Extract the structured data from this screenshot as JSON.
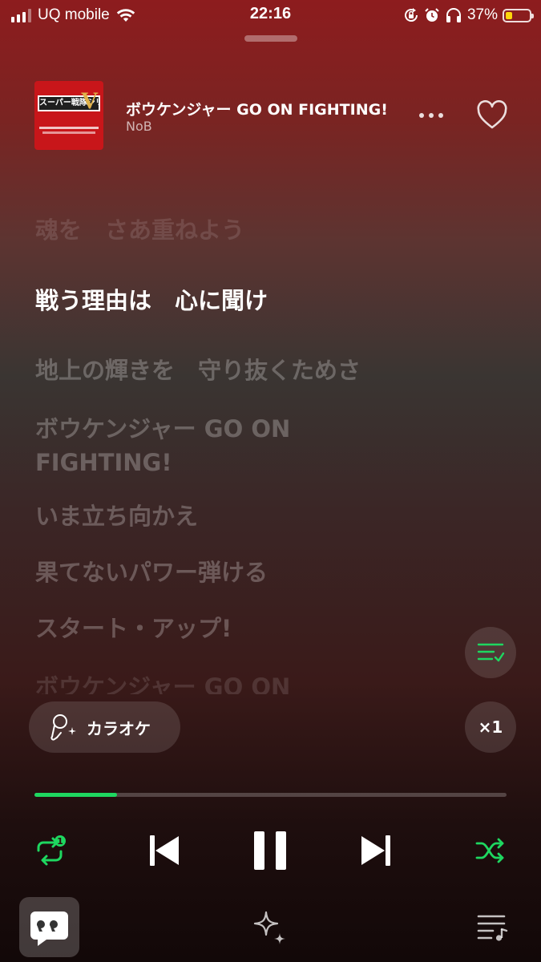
{
  "status_bar": {
    "carrier": "UQ mobile",
    "time": "22:16",
    "battery_percent": "37%",
    "battery_level": 0.37,
    "battery_color": "#ffd60a",
    "icons": [
      "signal-icon",
      "wifi-icon",
      "rotation-lock-icon",
      "alarm-icon",
      "headphones-icon",
      "battery-icon"
    ]
  },
  "track": {
    "title": "ボウケンジャー GO ON FIGHTING!",
    "artist": "NoB",
    "art_text": "スーパー戦隊シリーズ"
  },
  "lyrics": [
    {
      "text": "魂を　さあ重ねよう",
      "state": "past"
    },
    {
      "text": "戦う理由は　心に聞け",
      "state": "current"
    },
    {
      "text": "地上の輝きを　守り抜くためさ",
      "state": "upcoming"
    },
    {
      "text": "ボウケンジャー GO ON FIGHTING!",
      "state": "upcoming"
    },
    {
      "text": "いま立ち向かえ",
      "state": "upcoming"
    },
    {
      "text": "果てないパワー弾ける",
      "state": "upcoming"
    },
    {
      "text": "スタート・アップ!",
      "state": "upcoming"
    },
    {
      "text": "ボウケンジャー GO ON",
      "state": "upcoming"
    }
  ],
  "karaoke": {
    "label": "カラオケ"
  },
  "speed": {
    "label": "×1"
  },
  "playback": {
    "progress_fraction": 0.175,
    "accent_color": "#1ed760",
    "repeat_count": "1"
  },
  "controls": {
    "repeat": "repeat-one-icon",
    "previous": "skip-previous-icon",
    "play_pause": "pause-icon",
    "next": "skip-next-icon",
    "shuffle": "shuffle-icon"
  },
  "bottom_tabs": [
    "lyrics-quote-icon",
    "sparkle-icon",
    "queue-music-icon"
  ]
}
